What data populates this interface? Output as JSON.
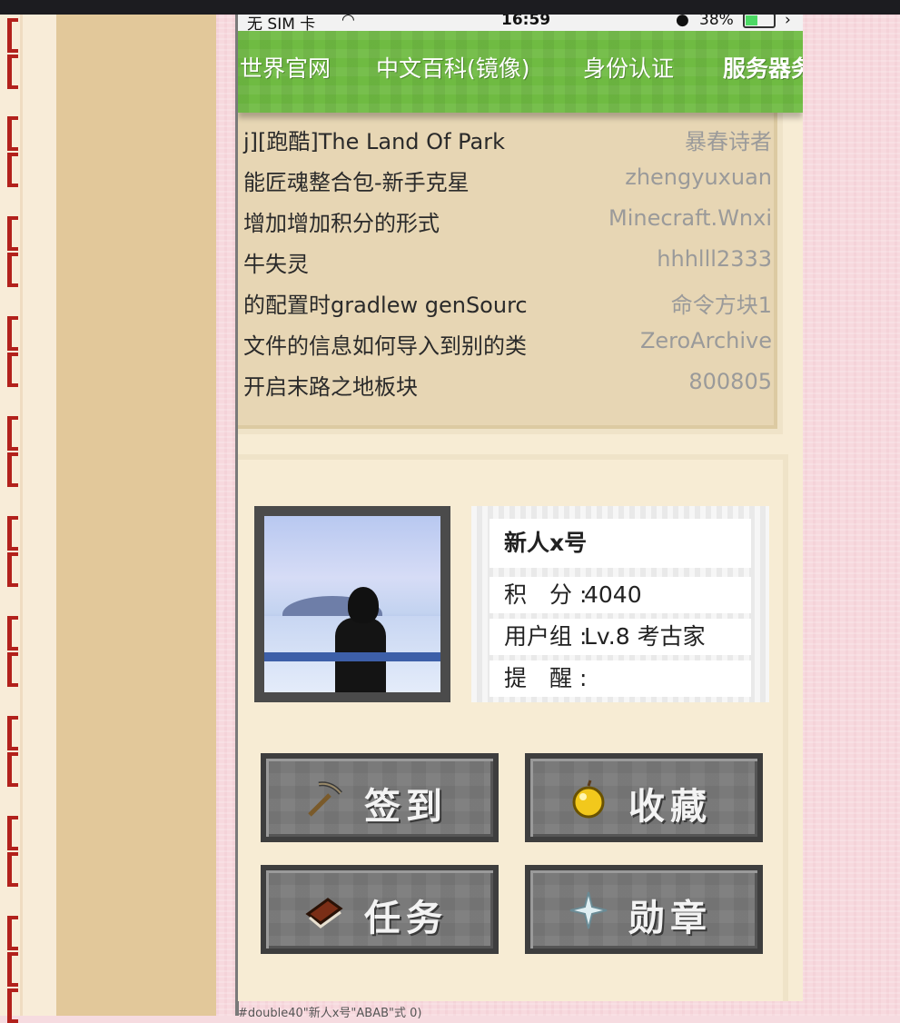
{
  "status_bar": {
    "carrier": "无 SIM 卡",
    "time": "16:59",
    "battery": "38%"
  },
  "nav": {
    "items": [
      {
        "label": "世界官网"
      },
      {
        "label": "中文百科(镜像)"
      },
      {
        "label": "身份认证"
      },
      {
        "label": "服务器务"
      }
    ]
  },
  "threads": [
    {
      "title": "j][跑酷]The Land Of Park",
      "author": "暴春诗者"
    },
    {
      "title": "能匠魂整合包-新手克星",
      "author": "zhengyuxuan"
    },
    {
      "title": "增加增加积分的形式",
      "author": "Minecraft.Wnxi"
    },
    {
      "title": "牛失灵",
      "author": "hhhlll2333"
    },
    {
      "title": "的配置时gradlew genSourc",
      "author": "命令方块1"
    },
    {
      "title": "文件的信息如何导入到别的类",
      "author": "ZeroArchive"
    },
    {
      "title": "开启末路之地板块",
      "author": "800805"
    }
  ],
  "profile": {
    "username": "新人x号",
    "points_label": "积　分 :",
    "points": "4040",
    "group_label": "用户组 :",
    "group": "Lv.8 考古家",
    "reminder_label": "提　醒 :",
    "reminder": ""
  },
  "actions": {
    "checkin": "签到",
    "favorites": "收藏",
    "tasks": "任务",
    "medals": "勋章"
  },
  "footer_text": "#double40\"新人x号\"ABAB\"式 0)",
  "colors": {
    "nav_green": "#6fbb42",
    "button_gray": "#7a7a7a",
    "bracket_red": "#b2211c"
  }
}
